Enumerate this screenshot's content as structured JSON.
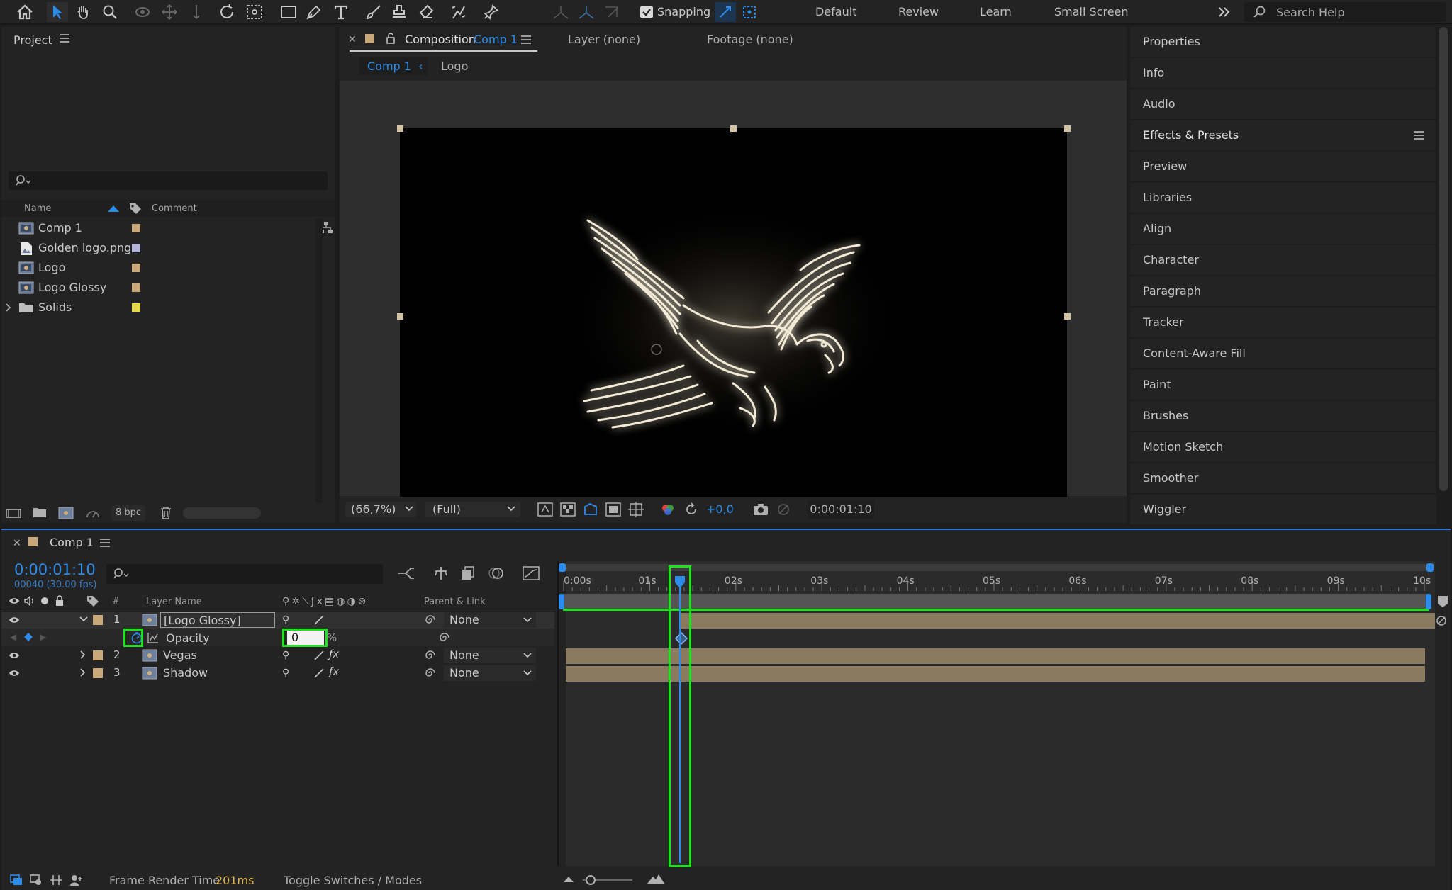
{
  "toolbar": {
    "snapping_label": "Snapping",
    "workspaces": [
      "Default",
      "Review",
      "Learn",
      "Small Screen"
    ],
    "search_placeholder": "Search Help"
  },
  "project": {
    "title": "Project",
    "columns": {
      "name": "Name",
      "comment": "Comment"
    },
    "items": [
      {
        "name": "Comp 1",
        "type": "composition",
        "color": "#c9a87a"
      },
      {
        "name": "Golden logo.png",
        "type": "image",
        "color": "#b5b5d8"
      },
      {
        "name": "Logo",
        "type": "composition",
        "color": "#c9a87a"
      },
      {
        "name": "Logo Glossy",
        "type": "composition",
        "color": "#c9a87a"
      },
      {
        "name": "Solids",
        "type": "folder",
        "color": "#e5d84a"
      }
    ],
    "bpc": "8 bpc"
  },
  "composition": {
    "tab_prefix": "Composition",
    "tab_name": "Comp 1",
    "layer_tab": "Layer (none)",
    "footage_tab": "Footage (none)",
    "breadcrumbs": [
      "Comp 1",
      "Logo"
    ],
    "zoom": "(66,7%)",
    "resolution": "(Full)",
    "exposure": "+0,0",
    "timecode": "0:00:01:10"
  },
  "right_panels": [
    "Properties",
    "Info",
    "Audio",
    "Effects & Presets",
    "Preview",
    "Libraries",
    "Align",
    "Character",
    "Paragraph",
    "Tracker",
    "Content-Aware Fill",
    "Paint",
    "Brushes",
    "Motion Sketch",
    "Smoother",
    "Wiggler"
  ],
  "timeline": {
    "comp_name": "Comp 1",
    "current_time": "0:00:01:10",
    "frame_info": "00040 (30.00 fps)",
    "columns": {
      "num": "#",
      "layer_name": "Layer Name",
      "parent": "Parent & Link"
    },
    "layers": [
      {
        "num": "1",
        "name": "[Logo Glossy]",
        "parent": "None"
      },
      {
        "num": "2",
        "name": "Vegas",
        "parent": "None"
      },
      {
        "num": "3",
        "name": "Shadow",
        "parent": "None"
      }
    ],
    "opacity": {
      "label": "Opacity",
      "value": "0",
      "unit": "%"
    },
    "ruler": [
      "0:00s",
      "01s",
      "02s",
      "03s",
      "04s",
      "05s",
      "06s",
      "07s",
      "08s",
      "09s",
      "10s"
    ],
    "playhead_time_seconds": 1.33,
    "duration_seconds": 10
  },
  "statusbar": {
    "render_label": "Frame Render Time",
    "render_value": "201ms",
    "toggle_label": "Toggle Switches / Modes"
  }
}
